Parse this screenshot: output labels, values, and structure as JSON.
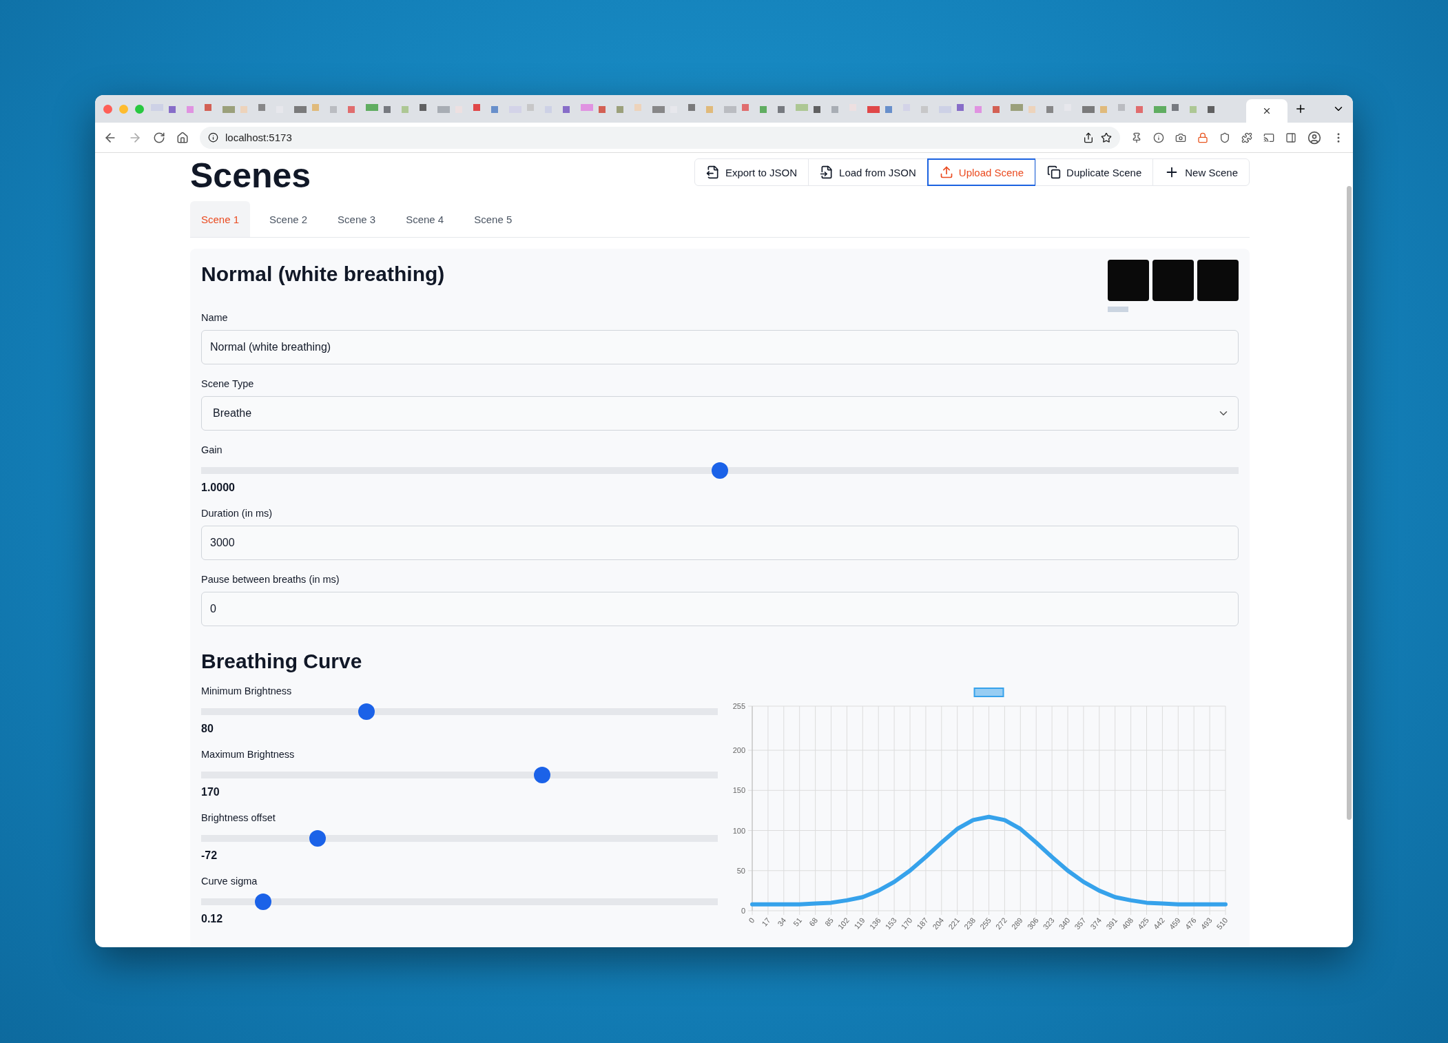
{
  "browser": {
    "url": "localhost:5173"
  },
  "page": {
    "title": "Scenes",
    "actions": [
      {
        "kind": "export",
        "label": "Export to JSON",
        "focused": false
      },
      {
        "kind": "load",
        "label": "Load from JSON",
        "focused": false
      },
      {
        "kind": "upload",
        "label": "Upload Scene",
        "focused": true
      },
      {
        "kind": "duplicate",
        "label": "Duplicate Scene",
        "focused": false
      },
      {
        "kind": "new",
        "label": "New Scene",
        "focused": false
      }
    ]
  },
  "tabs": [
    {
      "label": "Scene 1",
      "selected": true
    },
    {
      "label": "Scene 2",
      "selected": false
    },
    {
      "label": "Scene 3",
      "selected": false
    },
    {
      "label": "Scene 4",
      "selected": false
    },
    {
      "label": "Scene 5",
      "selected": false
    }
  ],
  "scene": {
    "title": "Normal (white breathing)",
    "swatches": [
      {
        "color": "#0a0a0a",
        "selected": true
      },
      {
        "color": "#0a0a0a",
        "selected": false
      },
      {
        "color": "#0a0a0a",
        "selected": false
      }
    ],
    "fields": [
      {
        "kind": "text",
        "label": "Name",
        "value": "Normal (white breathing)"
      },
      {
        "kind": "select",
        "label": "Scene Type",
        "value": "Breathe"
      },
      {
        "kind": "slider",
        "label": "Gain",
        "level": 0.5,
        "reading": "1.0000"
      },
      {
        "kind": "text",
        "label": "Duration (in ms)",
        "value": "3000"
      },
      {
        "kind": "text",
        "label": "Pause between breaths (in ms)",
        "value": "0"
      }
    ]
  },
  "curve": {
    "title": "Breathing Curve",
    "sliders": [
      {
        "label": "Minimum Brightness",
        "level": 0.32,
        "reading": "80"
      },
      {
        "label": "Maximum Brightness",
        "level": 0.66,
        "reading": "170"
      },
      {
        "label": "Brightness offset",
        "level": 0.225,
        "reading": "-72"
      },
      {
        "label": "Curve sigma",
        "level": 0.12,
        "reading": "0.12"
      }
    ],
    "chart_data": {
      "type": "line",
      "x": [
        0,
        17,
        34,
        51,
        68,
        85,
        102,
        119,
        136,
        153,
        170,
        187,
        204,
        221,
        238,
        255,
        272,
        289,
        306,
        323,
        340,
        357,
        374,
        391,
        408,
        425,
        442,
        459,
        476,
        493,
        510
      ],
      "series": [
        {
          "color": "#36a2eb",
          "values": [
            8,
            8,
            8,
            8,
            9,
            10,
            13,
            17,
            25,
            36,
            50,
            67,
            85,
            102,
            113,
            117,
            113,
            102,
            85,
            67,
            50,
            36,
            25,
            17,
            13,
            10,
            9,
            8,
            8,
            8,
            8
          ]
        }
      ],
      "grid": true,
      "xlim": [
        0,
        510
      ],
      "ylim": [
        0,
        255
      ],
      "xticks": [
        0,
        17,
        34,
        51,
        68,
        85,
        102,
        119,
        136,
        153,
        170,
        187,
        204,
        221,
        238,
        255,
        272,
        289,
        306,
        323,
        340,
        357,
        374,
        391,
        408,
        425,
        442,
        459,
        476,
        493,
        510
      ],
      "yticks": [
        0,
        50,
        100,
        150,
        200,
        255
      ]
    }
  }
}
